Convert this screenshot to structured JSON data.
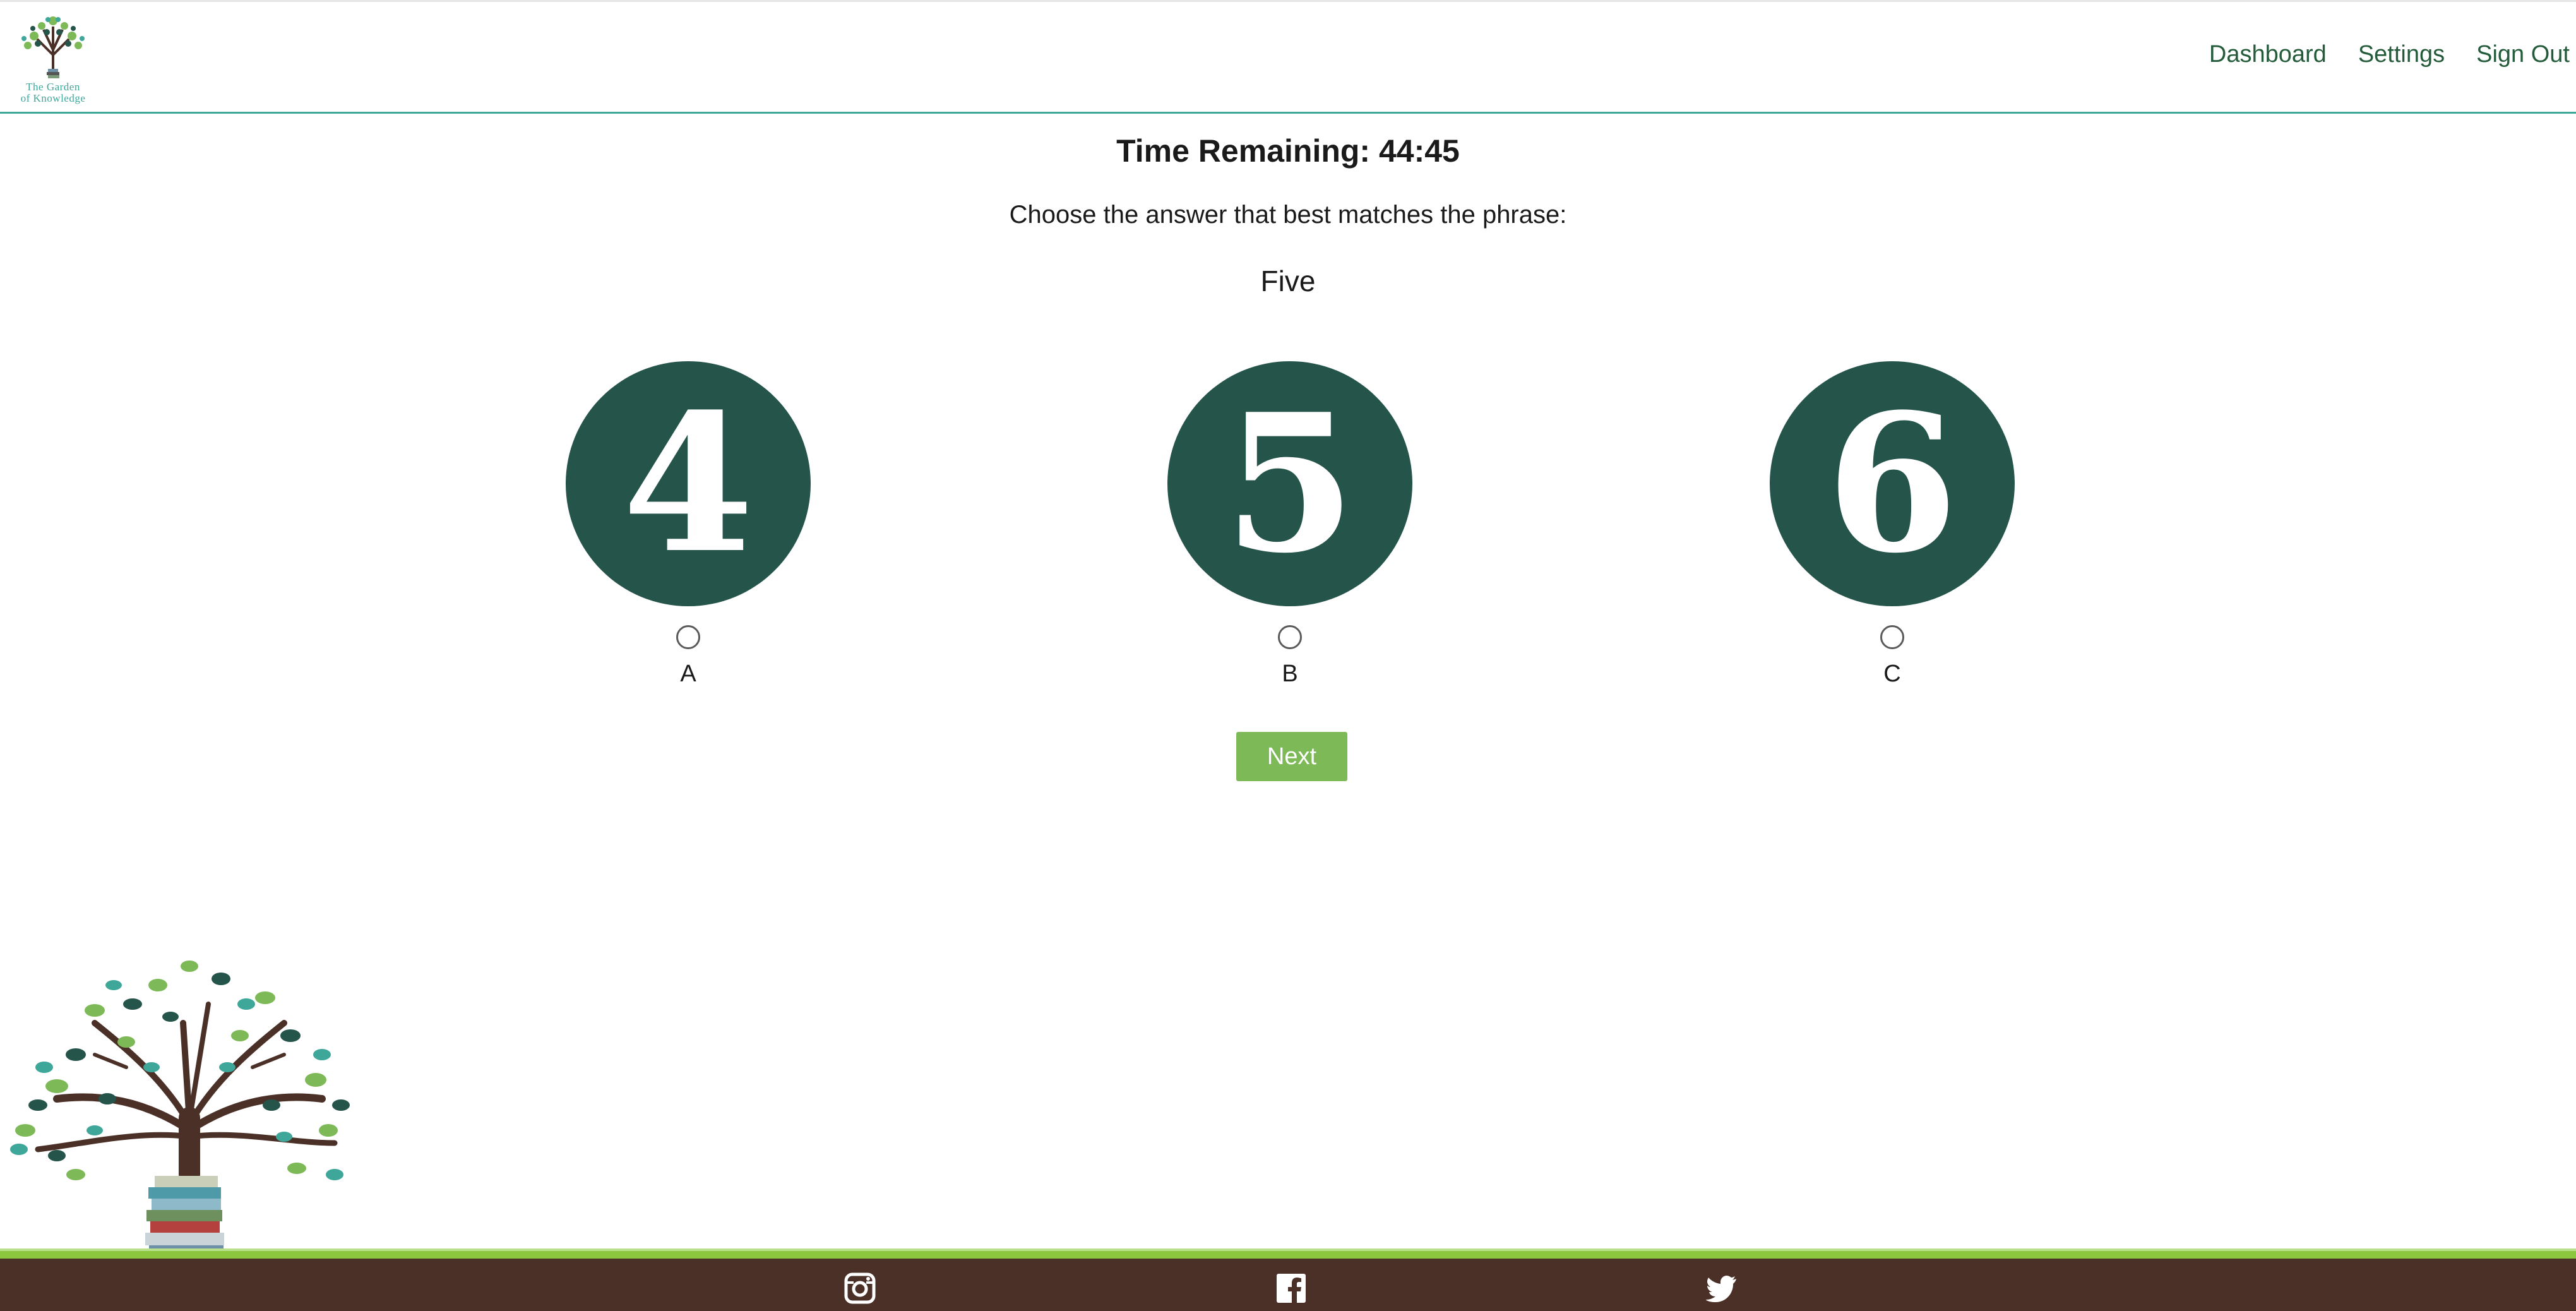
{
  "header": {
    "logo_text_line1": "The Garden",
    "logo_text_line2": "of Knowledge",
    "nav": {
      "dashboard": "Dashboard",
      "settings": "Settings",
      "sign_out": "Sign Out"
    }
  },
  "quiz": {
    "timer": "Time Remaining: 44:45",
    "prompt": "Choose the answer that best matches the phrase:",
    "phrase": "Five",
    "options": [
      {
        "value": "4",
        "label": "A"
      },
      {
        "value": "5",
        "label": "B"
      },
      {
        "value": "6",
        "label": "C"
      }
    ],
    "next_label": "Next"
  },
  "footer": {
    "icons": [
      "instagram-icon",
      "facebook-icon",
      "twitter-icon"
    ]
  },
  "colors": {
    "nav_text": "#245c3b",
    "circle_bg": "#24544a",
    "next_button": "#7dba57",
    "footer_bg": "#4a3026",
    "footer_line": "#8cc63f",
    "header_border": "#3fa79a"
  }
}
